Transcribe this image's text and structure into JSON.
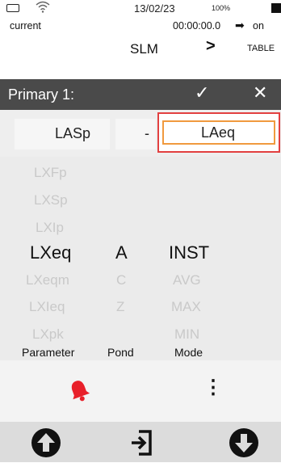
{
  "status": {
    "date": "13/02/23",
    "battery_percent": "100%",
    "icons": [
      "battery-icon",
      "wifi-icon",
      "battery-full-icon"
    ]
  },
  "info": {
    "mode": "current",
    "timer": "00:00:00.0",
    "state": "on"
  },
  "nav": {
    "title": "SLM",
    "next_symbol": ">",
    "next_label": "TABLE"
  },
  "header": {
    "title": "Primary 1:",
    "confirm_symbol": "✓",
    "close_symbol": "✕"
  },
  "fields": {
    "field1": "LASp",
    "separator": "-",
    "field2": "LAeq"
  },
  "picker": {
    "parameter": [
      "LXFp",
      "LXSp",
      "LXIp",
      "LXeq",
      "LXeqm",
      "LXIeq",
      "LXpk"
    ],
    "pond": [
      "A",
      "C",
      "Z"
    ],
    "mode": [
      "INST",
      "AVG",
      "MAX",
      "MIN"
    ],
    "selected": {
      "parameter": "LXeq",
      "pond": "A",
      "mode": "INST"
    },
    "labels": {
      "parameter": "Parameter",
      "pond": "Pond",
      "mode": "Mode"
    }
  },
  "actions": {
    "kebab_symbol": "⋮"
  },
  "colors": {
    "title_bar": "#4a4a4a",
    "alarm_red": "#e8202a",
    "selection_red": "#e24040",
    "selection_orange": "#f09a3e"
  }
}
